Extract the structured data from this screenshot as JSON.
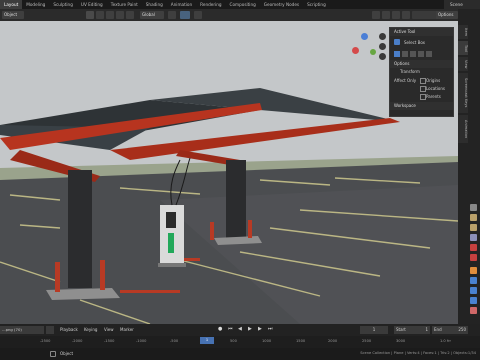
{
  "topbar": {
    "tabs": [
      "Layout",
      "Modeling",
      "Sculpting",
      "UV Editing",
      "Texture Paint",
      "Shading",
      "Animation",
      "Rendering",
      "Compositing",
      "Geometry Nodes",
      "Scripting"
    ],
    "active_index": 0,
    "scene_label": "Scene"
  },
  "header": {
    "mode_label": "Object",
    "orientation_label": "Global",
    "options_label": "Options"
  },
  "side_tabs": [
    "Item",
    "Tool",
    "View",
    "Screencast Keys",
    "Animation"
  ],
  "tool_panel": {
    "active_tool_header": "Active Tool",
    "tool_name": "Select Box",
    "options_header": "Options",
    "transform_header": "Transform",
    "affect_only_label": "Affect Only",
    "affect_only_options": [
      "Origins",
      "Locations",
      "Parents"
    ],
    "workspace_header": "Workspace"
  },
  "timeline": {
    "playback_label": "Playback",
    "keying_label": "Keying",
    "view_label": "View",
    "marker_label": "Marker",
    "current_frame": "1",
    "start_label": "Start",
    "start_value": "1",
    "end_label": "End",
    "end_value": "250",
    "ruler_ticks": [
      "-2500",
      "-2000",
      "-1500",
      "-1000",
      "-500",
      "0",
      "500",
      "1000",
      "1500",
      "2000",
      "2500",
      "3000"
    ],
    "frame_readout": "1.0 frr"
  },
  "status": {
    "left_text": "Object",
    "left_file": "...png (70)",
    "right_text": "Scene Collection | Plane | Verts:4 | Faces:1 | Tris:2 | Objects:1/34"
  }
}
